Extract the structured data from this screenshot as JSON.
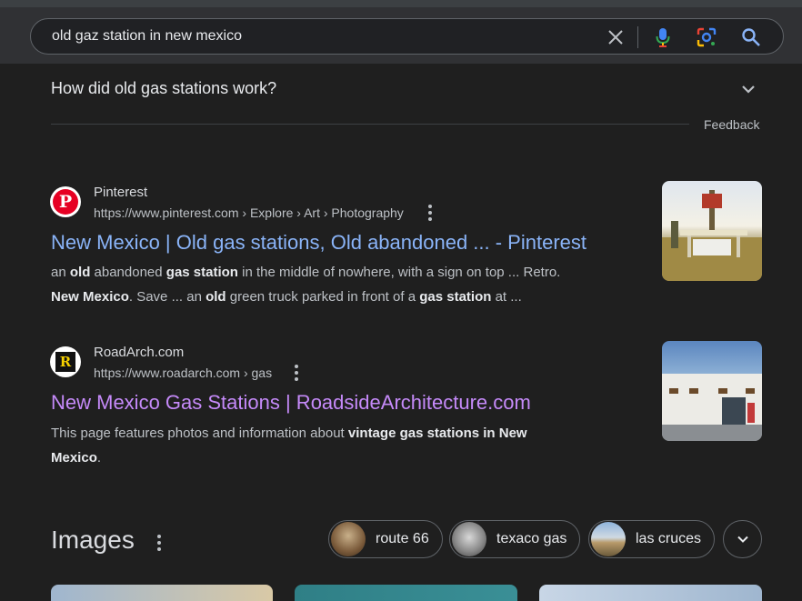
{
  "search": {
    "query": "old gaz station in new mexico",
    "icons": [
      "close-icon",
      "mic-icon",
      "lens-icon",
      "search-icon"
    ]
  },
  "faq": {
    "question": "How did old gas stations work?",
    "feedback": "Feedback"
  },
  "results": [
    {
      "site": "Pinterest",
      "url": "https://www.pinterest.com › Explore › Art › Photography",
      "title": "New Mexico | Old gas stations, Old abandoned ... - Pinterest",
      "snippet_line1": [
        {
          "t": "an ",
          "b": false
        },
        {
          "t": "old",
          "b": true
        },
        {
          "t": " abandoned ",
          "b": false
        },
        {
          "t": "gas station",
          "b": true
        },
        {
          "t": " in the middle of nowhere, with a sign on top ... Retro.",
          "b": false
        }
      ],
      "snippet_line2": [
        {
          "t": "New Mexico",
          "b": true
        },
        {
          "t": ". Save ... an ",
          "b": false
        },
        {
          "t": "old",
          "b": true
        },
        {
          "t": " green truck parked in front of a ",
          "b": false
        },
        {
          "t": "gas station",
          "b": true
        },
        {
          "t": " at ...",
          "b": false
        }
      ]
    },
    {
      "site": "RoadArch.com",
      "url": "https://www.roadarch.com › gas",
      "title": "New Mexico Gas Stations | RoadsideArchitecture.com",
      "snippet_line1": [
        {
          "t": "This page features photos and information about ",
          "b": false
        },
        {
          "t": "vintage gas stations in New",
          "b": true
        }
      ],
      "snippet_line2": [
        {
          "t": "Mexico",
          "b": true
        },
        {
          "t": ".",
          "b": false
        }
      ]
    }
  ],
  "images": {
    "title": "Images",
    "chips": [
      {
        "label": "route 66",
        "color": "#8a6a4a"
      },
      {
        "label": "texaco gas",
        "color": "#6a6e72"
      },
      {
        "label": "las cruces",
        "color": "#9a8a6a"
      }
    ]
  },
  "colors": {
    "link": "#8ab4f8",
    "visited": "#c58af9",
    "background": "#1f1f1f"
  }
}
